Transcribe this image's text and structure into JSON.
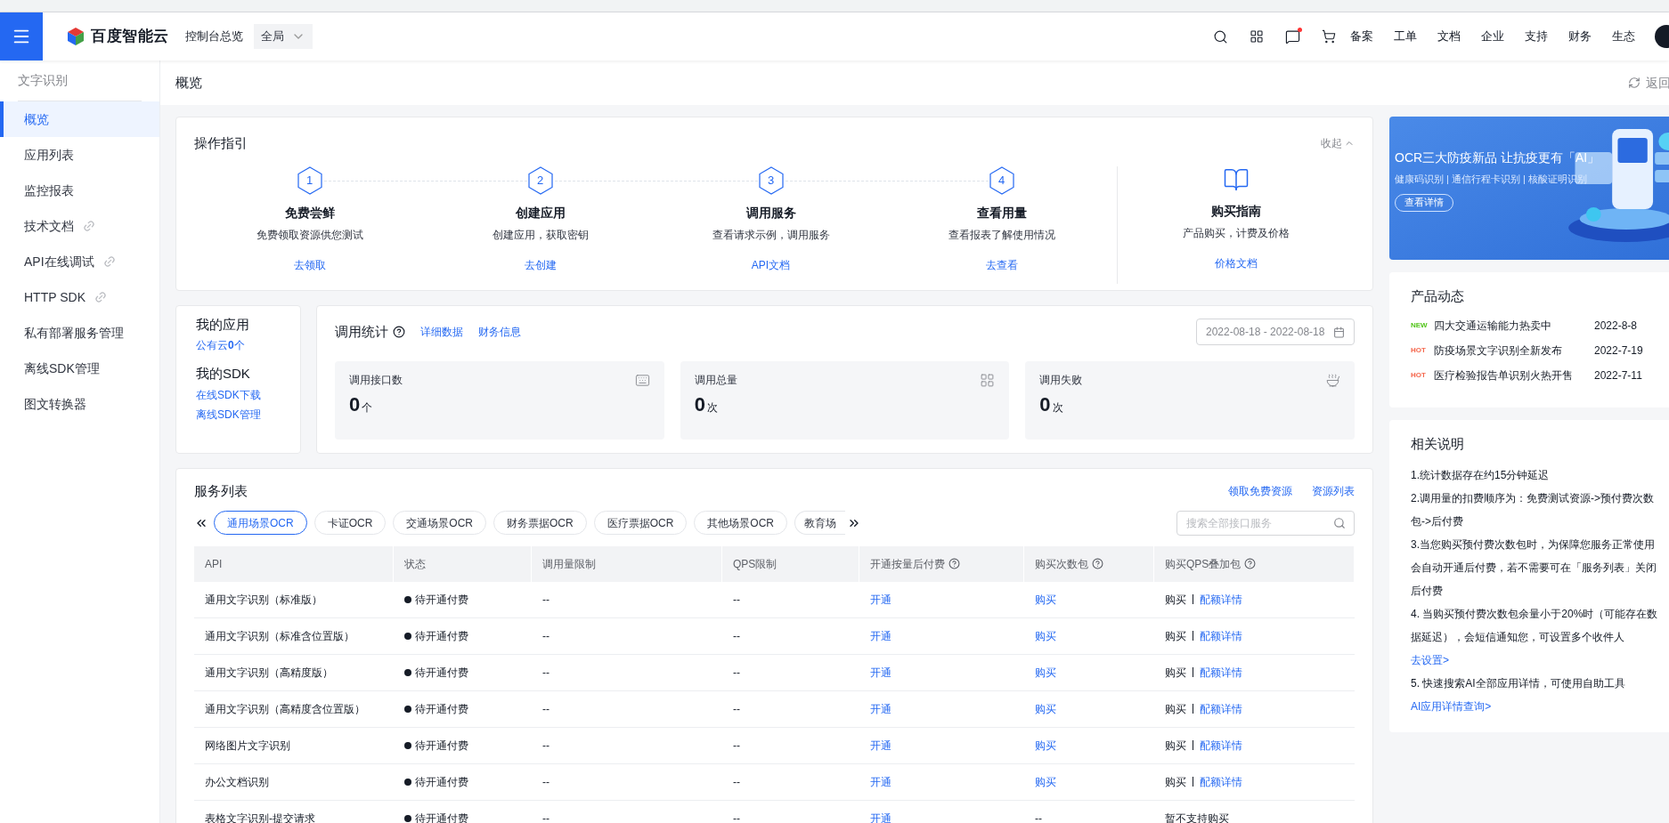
{
  "topbar": {
    "logo": "百度智能云",
    "console": "控制台总览",
    "region": "全局",
    "message_unread": true,
    "links": [
      "备案",
      "工单",
      "文档",
      "企业",
      "支持",
      "财务",
      "生态"
    ]
  },
  "sidebar": {
    "title": "文字识别",
    "items": [
      {
        "label": "概览",
        "selected": true,
        "external": false
      },
      {
        "label": "应用列表",
        "selected": false,
        "external": false
      },
      {
        "label": "监控报表",
        "selected": false,
        "external": false
      },
      {
        "label": "技术文档",
        "selected": false,
        "external": true
      },
      {
        "label": "API在线调试",
        "selected": false,
        "external": true
      },
      {
        "label": "HTTP SDK",
        "selected": false,
        "external": true
      },
      {
        "label": "私有部署服务管理",
        "selected": false,
        "external": false
      },
      {
        "label": "离线SDK管理",
        "selected": false,
        "external": false
      },
      {
        "label": "图文转换器",
        "selected": false,
        "external": false
      }
    ]
  },
  "page": {
    "title": "概览",
    "back": "返回"
  },
  "guide": {
    "title": "操作指引",
    "collapse": "收起",
    "steps": [
      {
        "kind": "step",
        "number": "1",
        "title": "免费尝鲜",
        "desc": "免费领取资源供您测试",
        "link": "去领取"
      },
      {
        "kind": "step",
        "number": "2",
        "title": "创建应用",
        "desc": "创建应用，获取密钥",
        "link": "去创建"
      },
      {
        "kind": "step",
        "number": "3",
        "title": "调用服务",
        "desc": "查看请求示例，调用服务",
        "link": "API文档"
      },
      {
        "kind": "step",
        "number": "4",
        "title": "查看用量",
        "desc": "查看报表了解使用情况",
        "link": "去查看"
      },
      {
        "kind": "guide",
        "title": "购买指南",
        "desc": "产品购买，计费及价格",
        "link": "价格文档"
      }
    ]
  },
  "my_apps": {
    "title": "我的应用",
    "public_cloud": "公有云**0**个",
    "sdk_title": "我的SDK",
    "sdk_links": [
      "在线SDK下载",
      "离线SDK管理"
    ]
  },
  "stats": {
    "title": "调用统计",
    "links": [
      "详细数据",
      "财务信息"
    ],
    "date_range": "2022-08-18 - 2022-08-18",
    "cards": [
      {
        "kind": "interfaces",
        "label": "调用接口数",
        "value": "0",
        "unit": "个"
      },
      {
        "kind": "total",
        "label": "调用总量",
        "value": "0",
        "unit": "次"
      },
      {
        "kind": "failed",
        "label": "调用失败",
        "value": "0",
        "unit": "次"
      }
    ]
  },
  "services": {
    "title": "服务列表",
    "links": [
      "领取免费资源",
      "资源列表"
    ],
    "tabs": [
      {
        "label": "通用场景OCR",
        "selected": true
      },
      {
        "label": "卡证OCR",
        "selected": false
      },
      {
        "label": "交通场景OCR",
        "selected": false
      },
      {
        "label": "财务票据OCR",
        "selected": false
      },
      {
        "label": "医疗票据OCR",
        "selected": false
      },
      {
        "label": "其他场景OCR",
        "selected": false
      },
      {
        "label": "教育场",
        "selected": false
      }
    ],
    "search": {
      "placeholder": "搜索全部接口服务"
    },
    "columns": [
      {
        "label": "API",
        "help": false
      },
      {
        "label": "状态",
        "help": false
      },
      {
        "label": "调用量限制",
        "help": false
      },
      {
        "label": "QPS限制",
        "help": false
      },
      {
        "label": "开通按量后付费",
        "help": true
      },
      {
        "label": "购买次数包",
        "help": true
      },
      {
        "label": "购买QPS叠加包",
        "help": true
      }
    ],
    "rows": [
      {
        "api": "通用文字识别（标准版）",
        "status": "待开通付费",
        "call_limit": "--",
        "qps_limit": "--",
        "postpaid": {
          "text": "开通",
          "kind": "link"
        },
        "pack": {
          "text": "购买",
          "kind": "link"
        },
        "qps_pack": [
          {
            "text": "购买",
            "kind": "plain"
          },
          {
            "text": "配额详情",
            "kind": "link"
          }
        ]
      },
      {
        "api": "通用文字识别（标准含位置版）",
        "status": "待开通付费",
        "call_limit": "--",
        "qps_limit": "--",
        "postpaid": {
          "text": "开通",
          "kind": "link"
        },
        "pack": {
          "text": "购买",
          "kind": "link"
        },
        "qps_pack": [
          {
            "text": "购买",
            "kind": "plain"
          },
          {
            "text": "配额详情",
            "kind": "link"
          }
        ]
      },
      {
        "api": "通用文字识别（高精度版）",
        "status": "待开通付费",
        "call_limit": "--",
        "qps_limit": "--",
        "postpaid": {
          "text": "开通",
          "kind": "link"
        },
        "pack": {
          "text": "购买",
          "kind": "link"
        },
        "qps_pack": [
          {
            "text": "购买",
            "kind": "plain"
          },
          {
            "text": "配额详情",
            "kind": "link"
          }
        ]
      },
      {
        "api": "通用文字识别（高精度含位置版）",
        "status": "待开通付费",
        "call_limit": "--",
        "qps_limit": "--",
        "postpaid": {
          "text": "开通",
          "kind": "link"
        },
        "pack": {
          "text": "购买",
          "kind": "link"
        },
        "qps_pack": [
          {
            "text": "购买",
            "kind": "plain"
          },
          {
            "text": "配额详情",
            "kind": "link"
          }
        ]
      },
      {
        "api": "网络图片文字识别",
        "status": "待开通付费",
        "call_limit": "--",
        "qps_limit": "--",
        "postpaid": {
          "text": "开通",
          "kind": "link"
        },
        "pack": {
          "text": "购买",
          "kind": "link"
        },
        "qps_pack": [
          {
            "text": "购买",
            "kind": "plain"
          },
          {
            "text": "配额详情",
            "kind": "link"
          }
        ]
      },
      {
        "api": "办公文档识别",
        "status": "待开通付费",
        "call_limit": "--",
        "qps_limit": "--",
        "postpaid": {
          "text": "开通",
          "kind": "link"
        },
        "pack": {
          "text": "购买",
          "kind": "link"
        },
        "qps_pack": [
          {
            "text": "购买",
            "kind": "plain"
          },
          {
            "text": "配额详情",
            "kind": "link"
          }
        ]
      },
      {
        "api": "表格文字识别-提交请求",
        "status": "待开通付费",
        "call_limit": "--",
        "qps_limit": "--",
        "postpaid": {
          "text": "开通",
          "kind": "link"
        },
        "pack": {
          "text": "--",
          "kind": "plain"
        },
        "qps_pack": [
          {
            "text": "暂不支持购买",
            "kind": "plain"
          }
        ]
      }
    ]
  },
  "banner": {
    "title": "OCR三大防疫新品 让抗疫更有「AI」",
    "subtitle": "健康码识别 | 通信行程卡识别 | 核酸证明识别",
    "button": "查看详情"
  },
  "news": {
    "title": "产品动态",
    "items": [
      {
        "tag": "NEW",
        "color": "#52c41a",
        "text": "四大交通运输能力热卖中",
        "date": "2022-8-8"
      },
      {
        "tag": "HOT",
        "color": "#f5684e",
        "text": "防疫场景文字识别全新发布",
        "date": "2022-7-19"
      },
      {
        "tag": "HOT",
        "color": "#f5684e",
        "text": "医疗检验报告单识别火热开售",
        "date": "2022-7-11"
      }
    ]
  },
  "notes": {
    "title": "相关说明",
    "items": [
      {
        "kind": "text",
        "text": "1.统计数据存在约15分钟延迟"
      },
      {
        "kind": "text",
        "text": "2.调用量的扣费顺序为：免费测试资源->预付费次数包->后付费"
      },
      {
        "kind": "text",
        "text": "3.当您购买预付费次数包时，为保障您服务正常使用会自动开通后付费，若不需要可在「服务列表」关闭后付费"
      },
      {
        "kind": "text",
        "text": "4. 当购买预付费次数包余量小于20%时（可能存在数据延迟），会短信通知您，可设置多个收件人"
      },
      {
        "kind": "link",
        "text": "去设置>"
      },
      {
        "kind": "text",
        "text": "5. 快速搜索AI全部应用详情，可使用自助工具",
        "link": "AI应用详情查询>"
      }
    ]
  }
}
